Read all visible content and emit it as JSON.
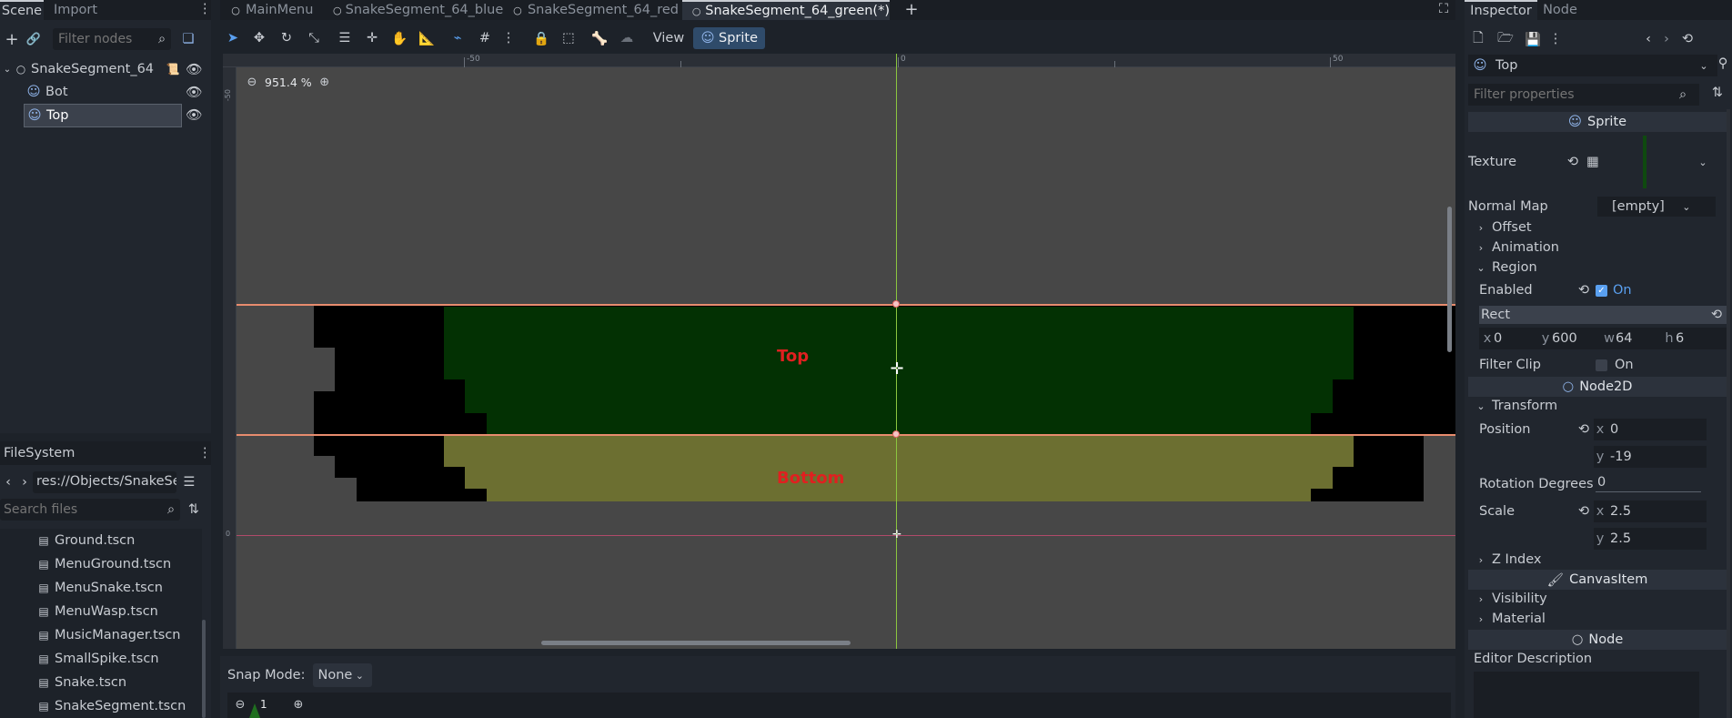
{
  "scene_dock": {
    "tabs": [
      "Scene",
      "Import"
    ],
    "filter_placeholder": "Filter nodes",
    "tree": [
      {
        "label": "SnakeSegment_64"
      },
      {
        "label": "Bot"
      },
      {
        "label": "Top"
      }
    ]
  },
  "filesystem": {
    "title": "FileSystem",
    "path": "res://Objects/SnakeSe",
    "search_placeholder": "Search files",
    "files": [
      "Ground.tscn",
      "MenuGround.tscn",
      "MenuSnake.tscn",
      "MenuWasp.tscn",
      "MusicManager.tscn",
      "SmallSpike.tscn",
      "Snake.tscn",
      "SnakeSegment.tscn"
    ]
  },
  "editor": {
    "tabs": [
      "MainMenu",
      "SnakeSegment_64_blue",
      "SnakeSegment_64_red",
      "SnakeSegment_64_green(*)"
    ],
    "view_menu": "View",
    "sprite_menu": "Sprite",
    "zoom": "951.4 %",
    "ruler_h": [
      "-50",
      "0",
      "50"
    ],
    "ruler_v": [
      "-50",
      "0"
    ],
    "label_top": "Top",
    "label_bottom": "Bottom",
    "label_color": "#e02020",
    "top_color": "#033103",
    "bottom_color": "#6c6f31",
    "snap_label": "Snap Mode:",
    "snap_value": "None",
    "frame_value": "1"
  },
  "inspector": {
    "tabs": [
      "Inspector",
      "Node"
    ],
    "node_name": "Top",
    "filter_placeholder": "Filter properties",
    "sections": {
      "sprite": "Sprite",
      "node2d": "Node2D",
      "canvasitem": "CanvasItem",
      "node": "Node"
    },
    "texture_label": "Texture",
    "normal_map_label": "Normal Map",
    "normal_map_value": "[empty]",
    "groups": {
      "offset": "Offset",
      "animation": "Animation",
      "region": "Region",
      "transform": "Transform",
      "zindex": "Z Index",
      "visibility": "Visibility",
      "material": "Material"
    },
    "enabled_label": "Enabled",
    "enabled_value": "On",
    "rect_label": "Rect",
    "rect": {
      "x": "0",
      "y": "600",
      "w": "64",
      "h": "6"
    },
    "filter_clip_label": "Filter Clip",
    "filter_clip_value": "On",
    "position_label": "Position",
    "position": {
      "x": "0",
      "y": "-19"
    },
    "rotation_label": "Rotation Degrees",
    "rotation_value": "0",
    "scale_label": "Scale",
    "scale": {
      "x": "2.5",
      "y": "2.5"
    },
    "editor_description_label": "Editor Description",
    "axis": {
      "x": "x",
      "y": "y",
      "w": "w",
      "h": "h"
    }
  }
}
